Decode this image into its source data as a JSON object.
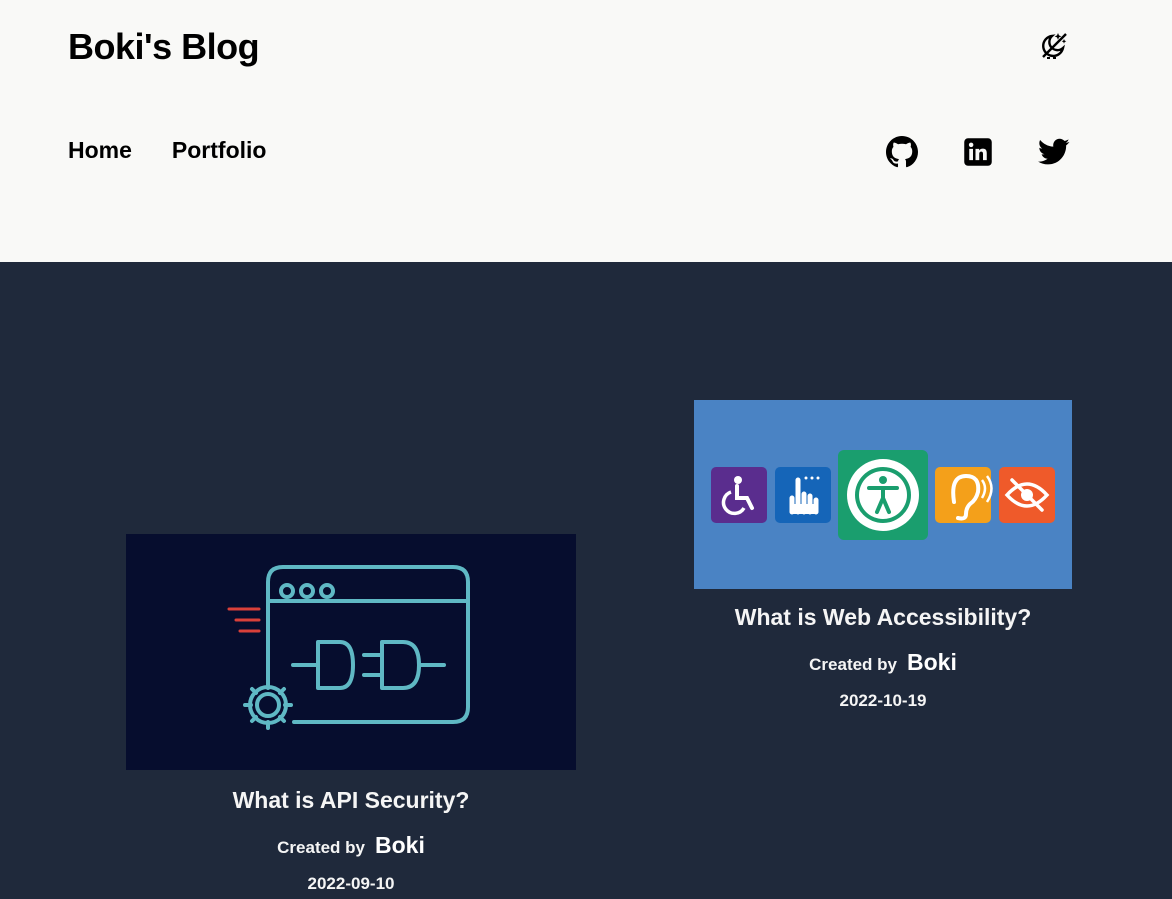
{
  "header": {
    "site_title": "Boki's Blog",
    "theme_toggle_icon": "moon-stars-crossed-icon",
    "nav": [
      {
        "label": "Home"
      },
      {
        "label": "Portfolio"
      }
    ],
    "socials": [
      {
        "icon": "github-icon"
      },
      {
        "icon": "linkedin-icon"
      },
      {
        "icon": "twitter-icon"
      }
    ]
  },
  "colors": {
    "header_bg": "#f9f9f7",
    "main_bg": "#1f293b",
    "text_light": "#f5f5f5",
    "api_image_bg": "#060d2e",
    "api_icon_stroke": "#5fb8c4",
    "a11y_image_bg": "#4a83c4"
  },
  "posts": [
    {
      "title": "What is API Security?",
      "created_by_label": "Created by",
      "author": "Boki",
      "date": "2022-09-10",
      "image_icon": "api-plug-icon"
    },
    {
      "title": "What is Web Accessibility?",
      "created_by_label": "Created by",
      "author": "Boki",
      "date": "2022-10-19",
      "image_icon": "accessibility-icons"
    }
  ]
}
